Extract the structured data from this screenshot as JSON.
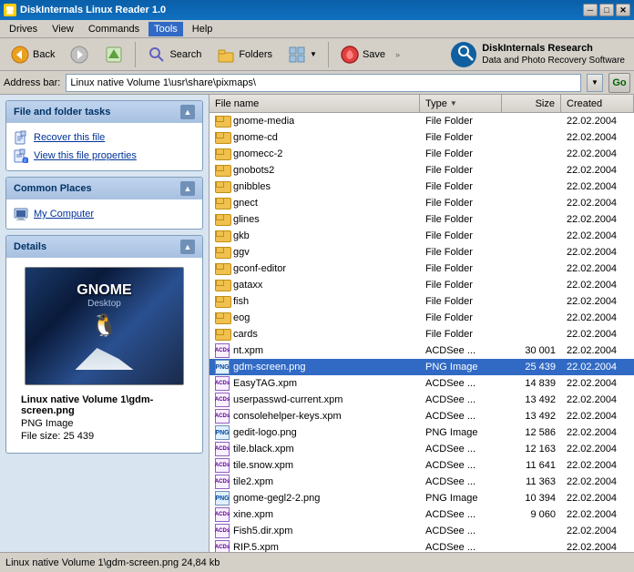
{
  "titleBar": {
    "title": "DiskInternals Linux Reader 1.0",
    "minimize": "─",
    "maximize": "□",
    "close": "✕"
  },
  "menuBar": {
    "items": [
      "Drives",
      "View",
      "Commands",
      "Tools",
      "Help"
    ],
    "activeItem": "Tools"
  },
  "toolbar": {
    "back": "Back",
    "forward": "",
    "up": "",
    "search": "Search",
    "folders": "Folders",
    "view": "",
    "save": "Save"
  },
  "branding": {
    "line1": "DiskInternals Research",
    "line2": "Data and Photo Recovery Software"
  },
  "addressBar": {
    "label": "Address bar:",
    "value": "Linux native Volume 1\\usr\\share\\pixmaps\\",
    "go": "Go"
  },
  "sidebar": {
    "fileFolderTasks": {
      "title": "File and folder tasks",
      "items": [
        {
          "icon": "📄",
          "label": "Recover this file",
          "color": "#003399"
        },
        {
          "icon": "📋",
          "label": "View this file properties",
          "color": "#003399"
        }
      ]
    },
    "commonPlaces": {
      "title": "Common Places",
      "items": [
        {
          "icon": "💻",
          "label": "My Computer"
        }
      ]
    },
    "details": {
      "title": "Details",
      "filename": "Linux native Volume 1\\gdm-screen.png",
      "type": "PNG Image",
      "filesize": "File size: 25 439"
    }
  },
  "fileList": {
    "columns": [
      {
        "label": "File name",
        "key": "name"
      },
      {
        "label": "Type",
        "key": "type"
      },
      {
        "label": "Size",
        "key": "size"
      },
      {
        "label": "Created",
        "key": "created"
      }
    ],
    "rows": [
      {
        "icon": "folder",
        "name": "gnome-media",
        "type": "File Folder",
        "typeCode": "DIR",
        "size": "",
        "created": "22.02.2004"
      },
      {
        "icon": "folder",
        "name": "gnome-cd",
        "type": "File Folder",
        "typeCode": "DIR",
        "size": "",
        "created": "22.02.2004"
      },
      {
        "icon": "folder",
        "name": "gnomecc-2",
        "type": "File Folder",
        "typeCode": "DIR",
        "size": "",
        "created": "22.02.2004"
      },
      {
        "icon": "folder",
        "name": "gnobots2",
        "type": "File Folder",
        "typeCode": "DIR",
        "size": "",
        "created": "22.02.2004"
      },
      {
        "icon": "folder",
        "name": "gnibbles",
        "type": "File Folder",
        "typeCode": "DIR",
        "size": "",
        "created": "22.02.2004"
      },
      {
        "icon": "folder",
        "name": "gnect",
        "type": "File Folder",
        "typeCode": "DIR",
        "size": "",
        "created": "22.02.2004"
      },
      {
        "icon": "folder",
        "name": "glines",
        "type": "File Folder",
        "typeCode": "DIR",
        "size": "",
        "created": "22.02.2004"
      },
      {
        "icon": "folder",
        "name": "gkb",
        "type": "File Folder",
        "typeCode": "DIR",
        "size": "",
        "created": "22.02.2004"
      },
      {
        "icon": "folder",
        "name": "ggv",
        "type": "File Folder",
        "typeCode": "DIR",
        "size": "",
        "created": "22.02.2004"
      },
      {
        "icon": "folder",
        "name": "gconf-editor",
        "type": "File Folder",
        "typeCode": "DIR",
        "size": "",
        "created": "22.02.2004"
      },
      {
        "icon": "folder",
        "name": "gataxx",
        "type": "File Folder",
        "typeCode": "DIR",
        "size": "",
        "created": "22.02.2004"
      },
      {
        "icon": "folder",
        "name": "fish",
        "type": "File Folder",
        "typeCode": "DIR",
        "size": "",
        "created": "22.02.2004"
      },
      {
        "icon": "folder",
        "name": "eog",
        "type": "File Folder",
        "typeCode": "DIR",
        "size": "",
        "created": "22.02.2004"
      },
      {
        "icon": "folder",
        "name": "cards",
        "type": "File Folder",
        "typeCode": "DIR",
        "size": "",
        "created": "22.02.2004"
      },
      {
        "icon": "acdsee",
        "name": "nt.xpm",
        "type": "ACDSee ...",
        "typeCode": "",
        "size": "30 001",
        "created": "22.02.2004"
      },
      {
        "icon": "png",
        "name": "gdm-screen.png",
        "type": "PNG Image",
        "typeCode": "",
        "size": "25 439",
        "created": "22.02.2004",
        "selected": true
      },
      {
        "icon": "acdsee",
        "name": "EasyTAG.xpm",
        "type": "ACDSee ...",
        "typeCode": "",
        "size": "14 839",
        "created": "22.02.2004"
      },
      {
        "icon": "acdsee",
        "name": "userpasswd-current.xpm",
        "type": "ACDSee ...",
        "typeCode": "",
        "size": "13 492",
        "created": "22.02.2004"
      },
      {
        "icon": "acdsee",
        "name": "consolehelper-keys.xpm",
        "type": "ACDSee ...",
        "typeCode": "",
        "size": "13 492",
        "created": "22.02.2004"
      },
      {
        "icon": "png",
        "name": "gedit-logo.png",
        "type": "PNG Image",
        "typeCode": "",
        "size": "12 586",
        "created": "22.02.2004"
      },
      {
        "icon": "acdsee",
        "name": "tile.black.xpm",
        "type": "ACDSee ...",
        "typeCode": "",
        "size": "12 163",
        "created": "22.02.2004"
      },
      {
        "icon": "acdsee",
        "name": "tile.snow.xpm",
        "type": "ACDSee ...",
        "typeCode": "",
        "size": "11 641",
        "created": "22.02.2004"
      },
      {
        "icon": "acdsee",
        "name": "tile2.xpm",
        "type": "ACDSee ...",
        "typeCode": "",
        "size": "11 363",
        "created": "22.02.2004"
      },
      {
        "icon": "png",
        "name": "gnome-gegl2-2.png",
        "type": "PNG Image",
        "typeCode": "",
        "size": "10 394",
        "created": "22.02.2004"
      },
      {
        "icon": "acdsee",
        "name": "xine.xpm",
        "type": "ACDSee ...",
        "typeCode": "",
        "size": "9 060",
        "created": "22.02.2004"
      },
      {
        "icon": "acdsee",
        "name": "Fish5.dir.xpm",
        "type": "ACDSee ...",
        "typeCode": "",
        "size": "",
        "created": "22.02.2004"
      },
      {
        "icon": "acdsee",
        "name": "RIP.5.xpm",
        "type": "ACDSee ...",
        "typeCode": "",
        "size": "",
        "created": "22.02.2004"
      }
    ]
  },
  "statusBar": {
    "text": "Linux native Volume 1\\gdm-screen.png  24,84 kb"
  }
}
